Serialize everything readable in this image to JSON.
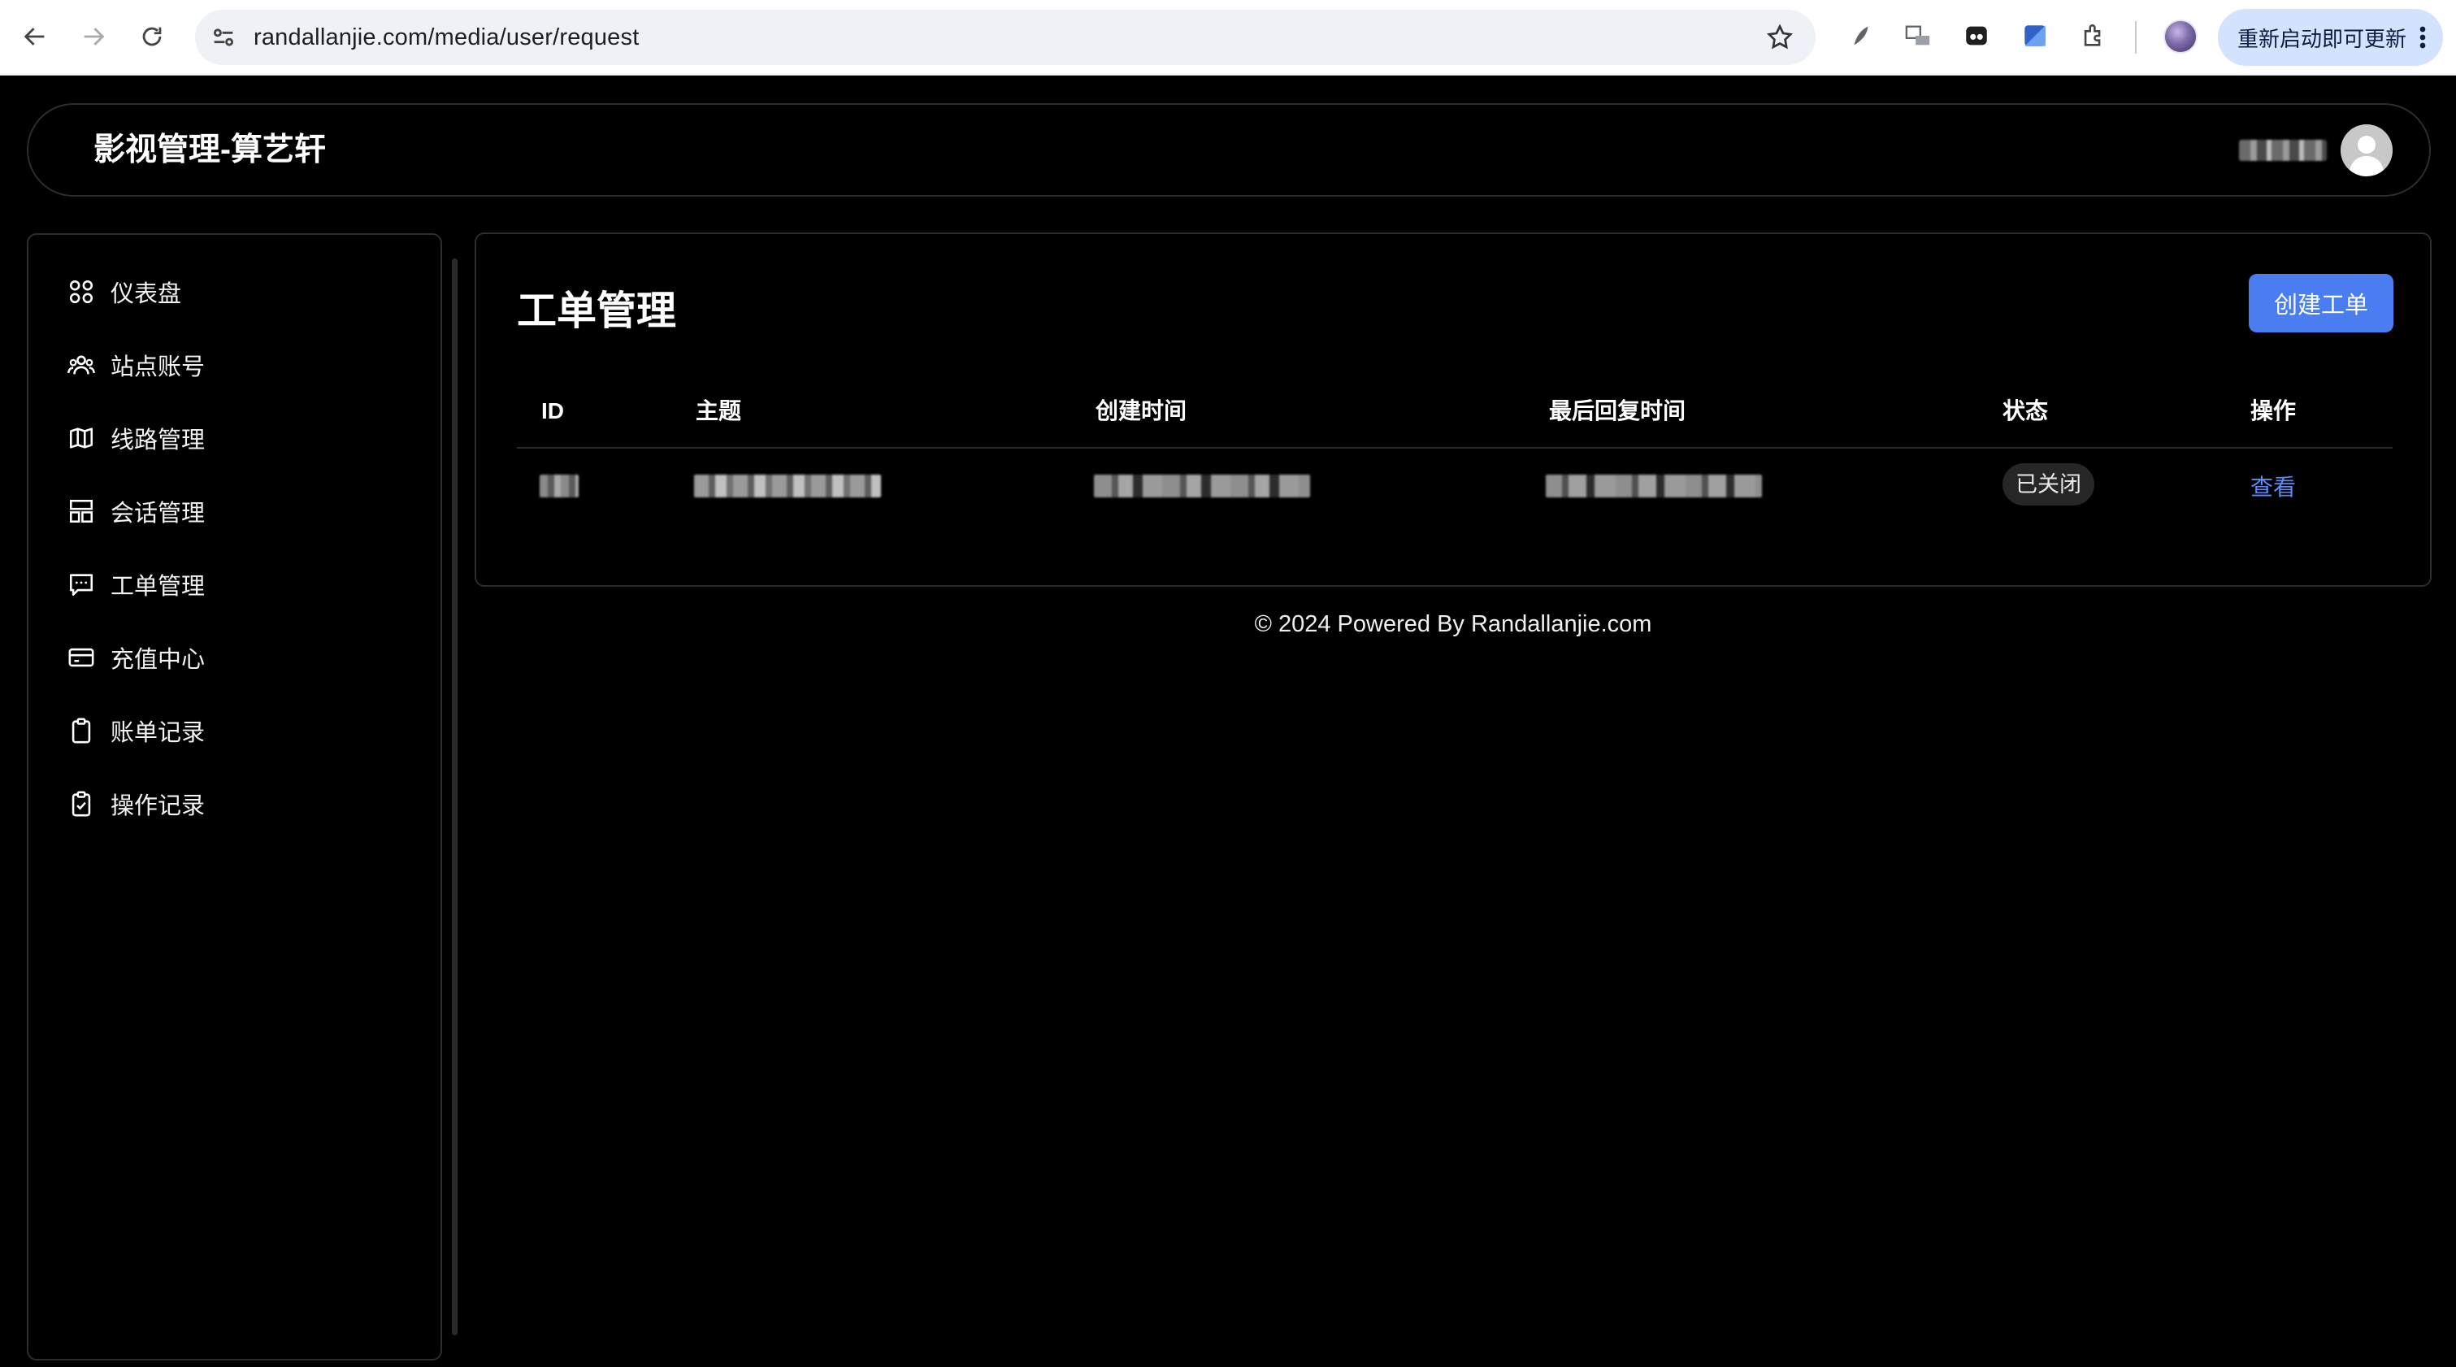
{
  "browser": {
    "url": "randallanjie.com/media/user/request",
    "update_label": "重新启动即可更新"
  },
  "header": {
    "app_title": "影视管理-算艺轩"
  },
  "sidebar": {
    "items": [
      {
        "label": "仪表盘",
        "icon": "dashboard-grid-icon"
      },
      {
        "label": "站点账号",
        "icon": "users-icon"
      },
      {
        "label": "线路管理",
        "icon": "map-icon"
      },
      {
        "label": "会话管理",
        "icon": "layout-icon"
      },
      {
        "label": "工单管理",
        "icon": "chat-bubble-icon"
      },
      {
        "label": "充值中心",
        "icon": "credit-card-icon"
      },
      {
        "label": "账单记录",
        "icon": "clipboard-icon"
      },
      {
        "label": "操作记录",
        "icon": "clipboard-check-icon"
      }
    ]
  },
  "main": {
    "title": "工单管理",
    "create_button": "创建工单",
    "table": {
      "columns": [
        "ID",
        "主题",
        "创建时间",
        "最后回复时间",
        "状态",
        "操作"
      ],
      "rows": [
        {
          "status": "已关闭",
          "action": "查看"
        }
      ]
    }
  },
  "footer": {
    "text": "© 2024 Powered By Randallanjie.com"
  },
  "colors": {
    "accent": "#4a7ef0",
    "link": "#5b8cf5",
    "background": "#000000",
    "border": "#2d2d2d"
  }
}
